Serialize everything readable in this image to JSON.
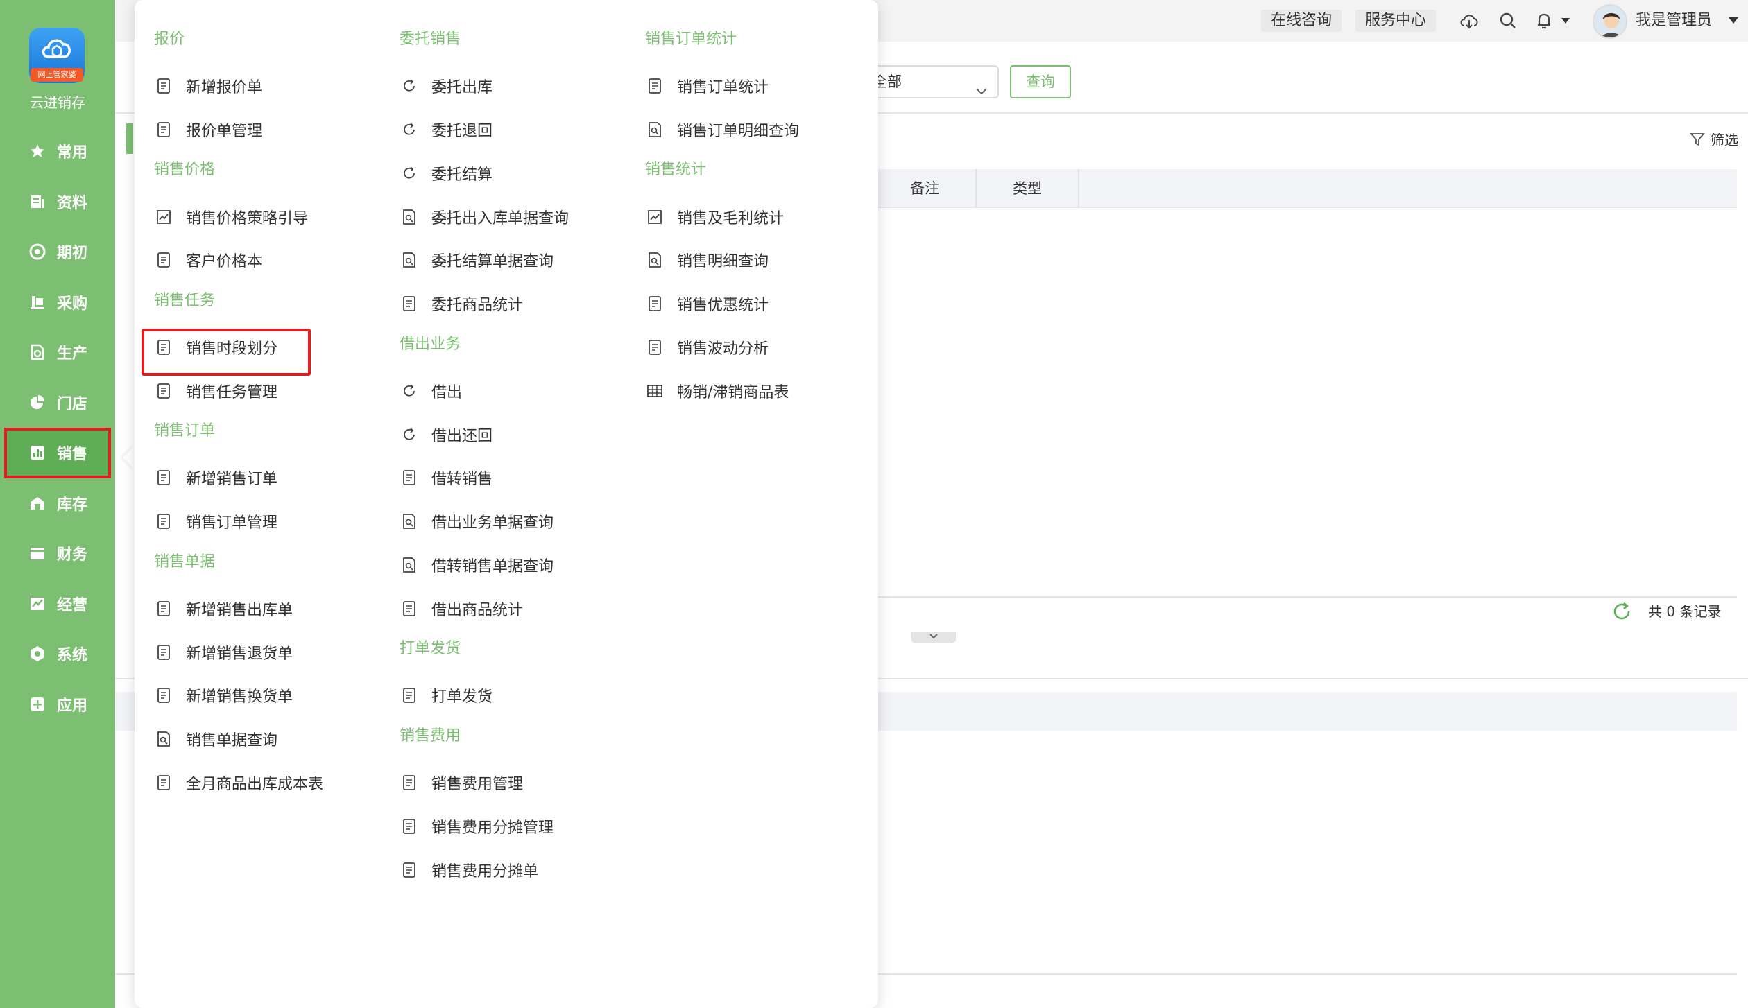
{
  "app": {
    "logo_badge": "网上管家婆",
    "name": "云进销存"
  },
  "sidebar": {
    "items": [
      {
        "label": "常用",
        "icon": "star-icon"
      },
      {
        "label": "资料",
        "icon": "document-icon"
      },
      {
        "label": "期初",
        "icon": "target-icon"
      },
      {
        "label": "采购",
        "icon": "purchase-icon"
      },
      {
        "label": "生产",
        "icon": "production-icon"
      },
      {
        "label": "门店",
        "icon": "pie-icon"
      },
      {
        "label": "销售",
        "icon": "bar-chart-icon",
        "active": true
      },
      {
        "label": "库存",
        "icon": "warehouse-icon"
      },
      {
        "label": "财务",
        "icon": "wallet-icon"
      },
      {
        "label": "经营",
        "icon": "trend-icon"
      },
      {
        "label": "系统",
        "icon": "settings-icon"
      },
      {
        "label": "应用",
        "icon": "plus-icon"
      }
    ]
  },
  "topbar": {
    "online_consult": "在线咨询",
    "service_center": "服务中心",
    "username": "我是管理员"
  },
  "background": {
    "select_value": "全部",
    "query_button": "查询",
    "filter_label": "筛选",
    "columns": [
      "备注",
      "类型"
    ],
    "record_count": "共 0 条记录"
  },
  "menu": {
    "columns": [
      {
        "groups": [
          {
            "title": "报价",
            "items": [
              "新增报价单",
              "报价单管理"
            ]
          },
          {
            "title": "销售价格",
            "items": [
              "销售价格策略引导",
              "客户价格本"
            ]
          },
          {
            "title": "销售任务",
            "items": [
              "销售时段划分",
              "销售任务管理"
            ]
          },
          {
            "title": "销售订单",
            "items": [
              "新增销售订单",
              "销售订单管理"
            ]
          },
          {
            "title": "销售单据",
            "items": [
              "新增销售出库单",
              "新增销售退货单",
              "新增销售换货单",
              "销售单据查询",
              "全月商品出库成本表"
            ]
          }
        ]
      },
      {
        "groups": [
          {
            "title": "委托销售",
            "items": [
              "委托出库",
              "委托退回",
              "委托结算",
              "委托出入库单据查询",
              "委托结算单据查询",
              "委托商品统计"
            ]
          },
          {
            "title": "借出业务",
            "items": [
              "借出",
              "借出还回",
              "借转销售",
              "借出业务单据查询",
              "借转销售单据查询",
              "借出商品统计"
            ]
          },
          {
            "title": "打单发货",
            "items": [
              "打单发货"
            ]
          },
          {
            "title": "销售费用",
            "items": [
              "销售费用管理",
              "销售费用分摊管理",
              "销售费用分摊单"
            ]
          }
        ]
      },
      {
        "groups": [
          {
            "title": "销售订单统计",
            "items": [
              "销售订单统计",
              "销售订单明细查询"
            ]
          },
          {
            "title": "销售统计",
            "items": [
              "销售及毛利统计",
              "销售明细查询",
              "销售优惠统计",
              "销售波动分析",
              "畅销/滞销商品表"
            ]
          }
        ]
      }
    ]
  }
}
